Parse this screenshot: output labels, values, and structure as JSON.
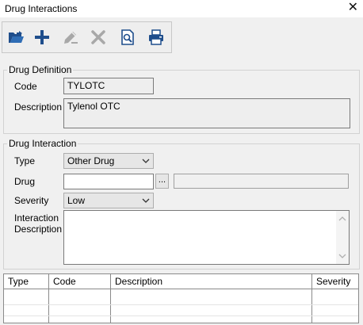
{
  "window": {
    "title": "Drug Interactions",
    "close_glyph": "✕"
  },
  "toolbar": {
    "buttons": [
      {
        "name": "open-folder-icon",
        "enabled": true
      },
      {
        "name": "add-icon",
        "enabled": true
      },
      {
        "name": "edit-icon",
        "enabled": false
      },
      {
        "name": "delete-icon",
        "enabled": false
      },
      {
        "name": "preview-icon",
        "enabled": true
      },
      {
        "name": "print-icon",
        "enabled": true
      }
    ]
  },
  "drug_definition": {
    "legend": "Drug Definition",
    "code_label": "Code",
    "code_value": "TYLOTC",
    "description_label": "Description",
    "description_value": "Tylenol OTC"
  },
  "drug_interaction": {
    "legend": "Drug Interaction",
    "type_label": "Type",
    "type_value": "Other Drug",
    "drug_label": "Drug",
    "drug_value": "",
    "ellipsis": "...",
    "severity_label": "Severity",
    "severity_value": "Low",
    "interaction_desc_label_1": "Interaction",
    "interaction_desc_label_2": "Description"
  },
  "grid": {
    "columns": [
      "Type",
      "Code",
      "Description",
      "Severity"
    ]
  },
  "colors": {
    "icon_blue": "#1f4e8c",
    "icon_gray": "#a8a8a8"
  }
}
